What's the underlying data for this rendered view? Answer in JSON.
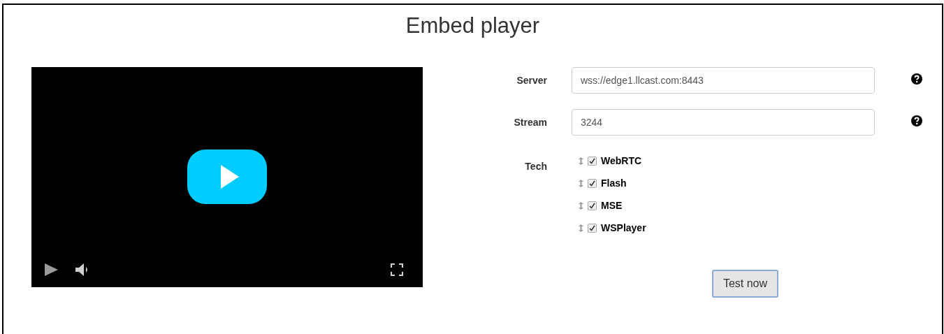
{
  "title": "Embed player",
  "fields": [
    {
      "label": "Server",
      "value": "wss://edge1.llcast.com:8443"
    },
    {
      "label": "Stream",
      "value": "3244"
    }
  ],
  "tech": {
    "label": "Tech",
    "items": [
      {
        "label": "WebRTC",
        "checked": true
      },
      {
        "label": "Flash",
        "checked": true
      },
      {
        "label": "MSE",
        "checked": true
      },
      {
        "label": "WSPlayer",
        "checked": true
      }
    ]
  },
  "button": "Test now"
}
